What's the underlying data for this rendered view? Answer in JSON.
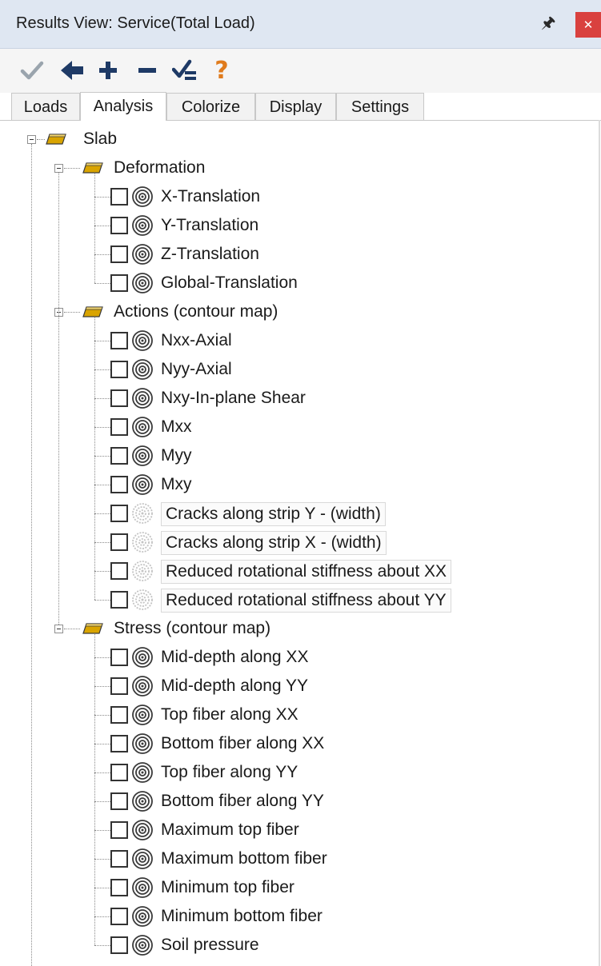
{
  "window": {
    "title": "Results View: Service(Total Load)"
  },
  "toolbar": {
    "icons": [
      "checkmark-icon",
      "arrow-left-icon",
      "plus-icon",
      "minus-icon",
      "check-list-icon",
      "help-icon"
    ],
    "help_glyph": "?"
  },
  "tabs": [
    {
      "label": "Loads",
      "active": false
    },
    {
      "label": "Analysis",
      "active": true
    },
    {
      "label": "Colorize",
      "active": false
    },
    {
      "label": "Display",
      "active": false
    },
    {
      "label": "Settings",
      "active": false
    }
  ],
  "tree": {
    "root": {
      "label": "Slab"
    },
    "groups": [
      {
        "label": "Deformation",
        "items": [
          {
            "label": "X-Translation",
            "enabled": true
          },
          {
            "label": "Y-Translation",
            "enabled": true
          },
          {
            "label": "Z-Translation",
            "enabled": true
          },
          {
            "label": "Global-Translation",
            "enabled": true
          }
        ]
      },
      {
        "label": "Actions (contour map)",
        "items": [
          {
            "label": "Nxx-Axial",
            "enabled": true
          },
          {
            "label": "Nyy-Axial",
            "enabled": true
          },
          {
            "label": "Nxy-In-plane Shear",
            "enabled": true
          },
          {
            "label": "Mxx",
            "enabled": true
          },
          {
            "label": "Myy",
            "enabled": true
          },
          {
            "label": "Mxy",
            "enabled": true
          },
          {
            "label": "Cracks along strip Y - (width)",
            "enabled": false
          },
          {
            "label": "Cracks along strip X - (width)",
            "enabled": false
          },
          {
            "label": "Reduced rotational stiffness about XX",
            "enabled": false
          },
          {
            "label": "Reduced rotational stiffness about YY",
            "enabled": false
          }
        ]
      },
      {
        "label": "Stress (contour map)",
        "items": [
          {
            "label": "Mid-depth along XX",
            "enabled": true
          },
          {
            "label": "Mid-depth along YY",
            "enabled": true
          },
          {
            "label": "Top fiber along XX",
            "enabled": true
          },
          {
            "label": "Bottom fiber along XX",
            "enabled": true
          },
          {
            "label": "Top fiber along YY",
            "enabled": true
          },
          {
            "label": "Bottom fiber along YY",
            "enabled": true
          },
          {
            "label": "Maximum top fiber",
            "enabled": true
          },
          {
            "label": "Maximum bottom fiber",
            "enabled": true
          },
          {
            "label": "Minimum top fiber",
            "enabled": true
          },
          {
            "label": "Minimum bottom fiber",
            "enabled": true
          },
          {
            "label": "Soil pressure",
            "enabled": true
          }
        ]
      }
    ]
  },
  "colors": {
    "folder_icon": "#d9a400",
    "toolbar_icon": "#1e3a66",
    "help_icon": "#e07b1c",
    "close_button": "#d9413f"
  }
}
